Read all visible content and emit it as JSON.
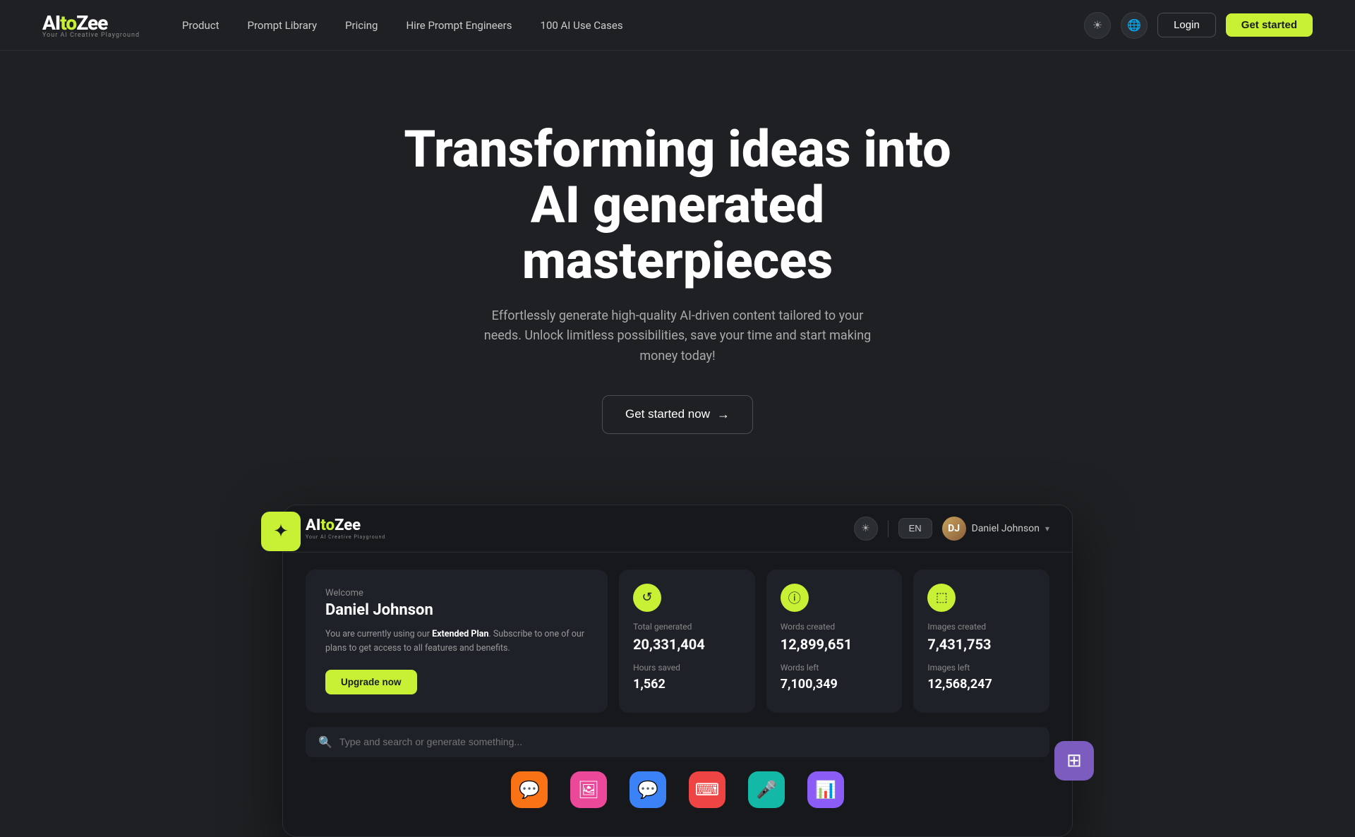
{
  "brand": {
    "name_ai": "AI",
    "name_to": "to",
    "name_zee": "Zee",
    "tagline": "Your AI Creative Playground"
  },
  "navbar": {
    "links": [
      {
        "label": "Product",
        "id": "product"
      },
      {
        "label": "Prompt Library",
        "id": "prompt-library"
      },
      {
        "label": "Pricing",
        "id": "pricing"
      },
      {
        "label": "Hire Prompt Engineers",
        "id": "hire"
      },
      {
        "label": "100 AI Use Cases",
        "id": "use-cases"
      }
    ],
    "login_label": "Login",
    "get_started_label": "Get started"
  },
  "hero": {
    "title": "Transforming ideas into AI generated masterpieces",
    "subtitle": "Effortlessly generate high-quality AI-driven content tailored to your needs. Unlock limitless possibilities, save your time and start making money today!",
    "cta_label": "Get started now"
  },
  "dashboard": {
    "lang": "EN",
    "user_name": "Daniel Johnson",
    "user_initials": "DJ",
    "search_placeholder": "Type and search or generate something...",
    "welcome": {
      "label": "Welcome",
      "name": "Daniel Johnson",
      "desc_prefix": "You are currently using our ",
      "plan": "Extended Plan",
      "desc_suffix": ". Subscribe to one of our plans to get access to all features and benefits.",
      "upgrade_label": "Upgrade now"
    },
    "stats": [
      {
        "icon": "↺",
        "icon_class": "yellow",
        "label": "Total generated",
        "value": "20,331,404",
        "sub_label": "Hours saved",
        "sub_value": "1,562"
      },
      {
        "icon": "ℹ",
        "icon_class": "green",
        "label": "Words created",
        "value": "12,899,651",
        "sub_label": "Words left",
        "sub_value": "7,100,349"
      },
      {
        "icon": "🖼",
        "icon_class": "green2",
        "label": "Images created",
        "value": "7,431,753",
        "sub_label": "Images left",
        "sub_value": "12,568,247"
      }
    ],
    "tools": [
      {
        "icon": "💬",
        "color": "orange"
      },
      {
        "icon": "🖼",
        "color": "pink"
      },
      {
        "icon": "💬",
        "color": "blue"
      },
      {
        "icon": "⌨",
        "color": "red"
      },
      {
        "icon": "🎤",
        "color": "teal"
      },
      {
        "icon": "📊",
        "color": "purple"
      }
    ]
  }
}
